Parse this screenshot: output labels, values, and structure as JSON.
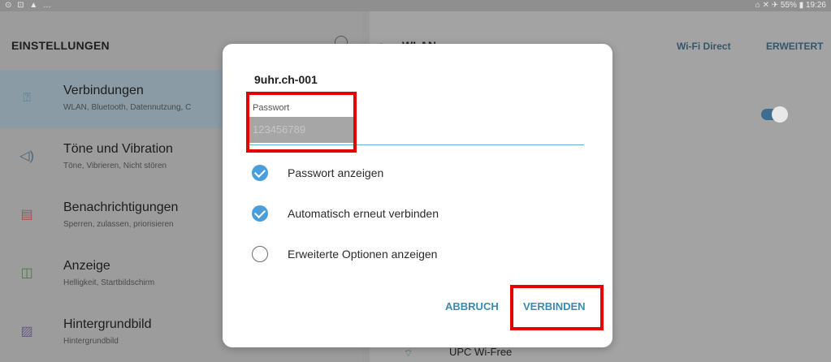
{
  "status_bar": {
    "left_icons": "⊙ ⊡ ▲ …",
    "right_text": "⌂ ✕ ✈ 55% ▮ 19:26"
  },
  "left_panel": {
    "title": "EINSTELLUNGEN",
    "items": [
      {
        "title": "Verbindungen",
        "subtitle": "WLAN, Bluetooth, Datennutzung, C",
        "icon": "connections-icon",
        "glyph": "⍰"
      },
      {
        "title": "Töne und Vibration",
        "subtitle": "Töne, Vibrieren, Nicht stören",
        "icon": "speaker-icon",
        "glyph": "◁)"
      },
      {
        "title": "Benachrichtigungen",
        "subtitle": "Sperren, zulassen, priorisieren",
        "icon": "notifications-icon",
        "glyph": "▤"
      },
      {
        "title": "Anzeige",
        "subtitle": "Helligkeit, Startbildschirm",
        "icon": "display-icon",
        "glyph": "◫"
      },
      {
        "title": "Hintergrundbild",
        "subtitle": "Hintergrundbild",
        "icon": "wallpaper-icon",
        "glyph": "▨"
      }
    ]
  },
  "right_panel": {
    "title": "WLAN",
    "wifi_direct": "Wi-Fi Direct",
    "advanced": "ERWEITERT",
    "network_name": "UPC Wi-Free",
    "toggle_on": true
  },
  "dialog": {
    "title": "9uhr.ch-001",
    "password_label": "Passwort",
    "password_value": "123456789",
    "options": [
      {
        "label": "Passwort anzeigen",
        "checked": true
      },
      {
        "label": "Automatisch erneut verbinden",
        "checked": true
      },
      {
        "label": "Erweiterte Optionen anzeigen",
        "checked": false
      }
    ],
    "cancel_label": "ABBRUCH",
    "connect_label": "VERBINDEN"
  },
  "colors": {
    "accent_blue": "#4a9edb",
    "button_text": "#3b8ab0",
    "annotation_red": "#e40000"
  }
}
